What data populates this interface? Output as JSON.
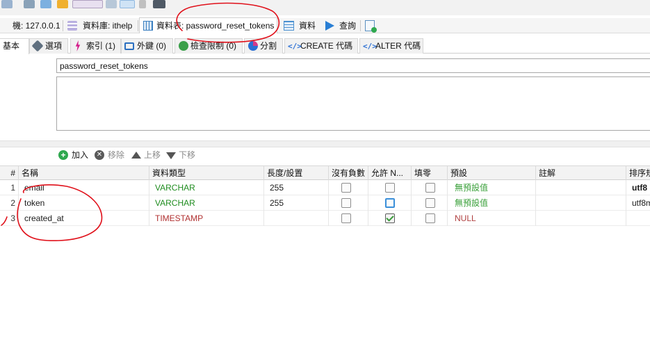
{
  "breadcrumbs": {
    "host": "機: 127.0.0.1",
    "database": "資料庫: ithelp",
    "table": "資料表: password_reset_tokens",
    "data": "資料",
    "query": "查詢"
  },
  "tabs": [
    {
      "label": "基本"
    },
    {
      "label": "選項"
    },
    {
      "label": "索引 (1)"
    },
    {
      "label": "外鍵 (0)"
    },
    {
      "label": "檢查限制 (0)"
    },
    {
      "label": "分割"
    },
    {
      "label": "CREATE 代碼"
    },
    {
      "label": "ALTER 代碼"
    }
  ],
  "table_name": {
    "value": "password_reset_tokens"
  },
  "actions": {
    "add": "加入",
    "remove": "移除",
    "move_up": "上移",
    "move_down": "下移"
  },
  "columns": {
    "num": "#",
    "name": "名稱",
    "type": "資料類型",
    "length": "長度/設置",
    "unsigned": "沒有負數",
    "nullable": "允許 N...",
    "zerofill": "填零",
    "default": "預設",
    "comment": "註解",
    "collation": "排序規"
  },
  "rows": [
    {
      "num": "1",
      "name": "email",
      "type": "VARCHAR",
      "length": "255",
      "unsigned": false,
      "nullable": false,
      "zerofill": false,
      "default": "無預設值",
      "comment": "",
      "collation": "utf8"
    },
    {
      "num": "2",
      "name": "token",
      "type": "VARCHAR",
      "length": "255",
      "unsigned": false,
      "nullable": false,
      "zerofill": false,
      "default": "無預設值",
      "comment": "",
      "collation": "utf8m"
    },
    {
      "num": "3",
      "name": "created_at",
      "type": "TIMESTAMP",
      "length": "",
      "unsigned": false,
      "nullable": true,
      "zerofill": false,
      "default": "NULL",
      "comment": "",
      "collation": ""
    }
  ],
  "colors": {
    "accent_red_annotation": "#e0101a",
    "type_varchar": "#1f8c1f",
    "type_timestamp": "#b03030",
    "focus_blue": "#3a8fd9"
  }
}
